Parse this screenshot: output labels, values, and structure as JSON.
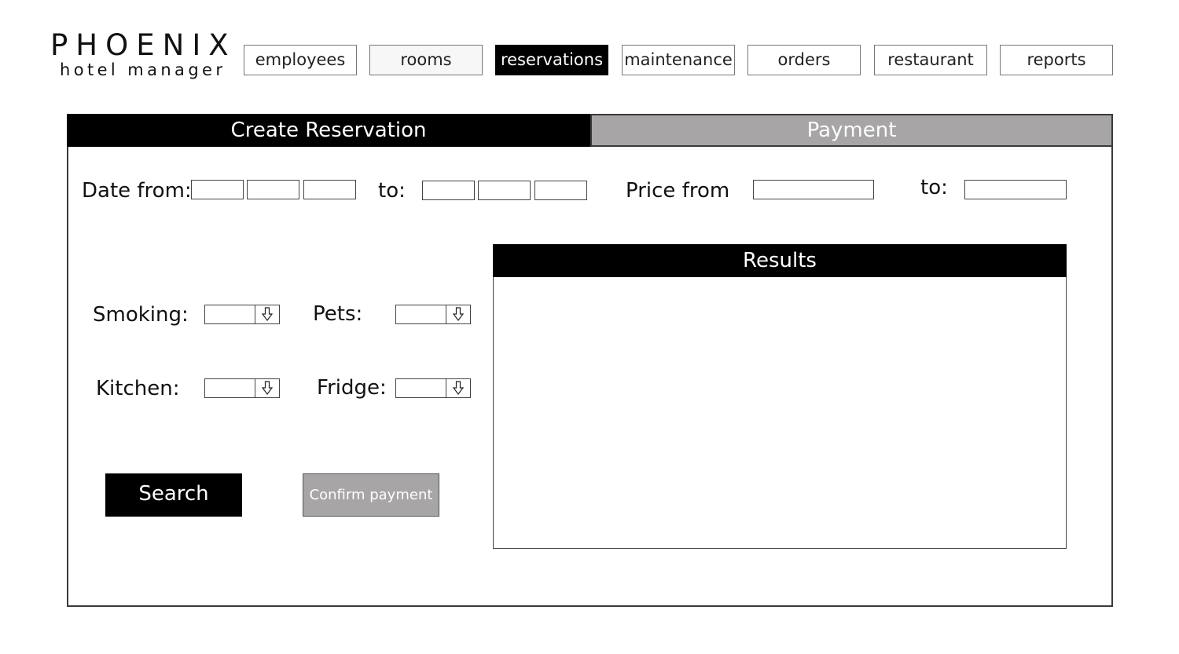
{
  "logo": {
    "title": "PHOENIX",
    "subtitle": "hotel manager"
  },
  "nav": {
    "items": [
      {
        "label": "employees"
      },
      {
        "label": "rooms"
      },
      {
        "label": "reservations",
        "active": true
      },
      {
        "label": "maintenance"
      },
      {
        "label": "orders"
      },
      {
        "label": "restaurant"
      },
      {
        "label": "reports"
      }
    ]
  },
  "tabs": {
    "create": "Create Reservation",
    "payment": "Payment"
  },
  "form": {
    "date_from_label": "Date from:",
    "date_to_label": "to:",
    "price_from_label": "Price from",
    "price_to_label": "to:",
    "smoking_label": "Smoking:",
    "pets_label": "Pets:",
    "kitchen_label": "Kitchen:",
    "fridge_label": "Fridge:",
    "date_from": [
      "",
      "",
      ""
    ],
    "date_to": [
      "",
      "",
      ""
    ],
    "price_from": "",
    "price_to": ""
  },
  "results": {
    "title": "Results"
  },
  "buttons": {
    "search": "Search",
    "confirm_payment": "Confirm payment"
  },
  "icons": {
    "dropdown": "arrow-down-icon"
  },
  "colors": {
    "active": "#000000",
    "inactive_tab": "#a7a5a6",
    "border": "#444444"
  }
}
